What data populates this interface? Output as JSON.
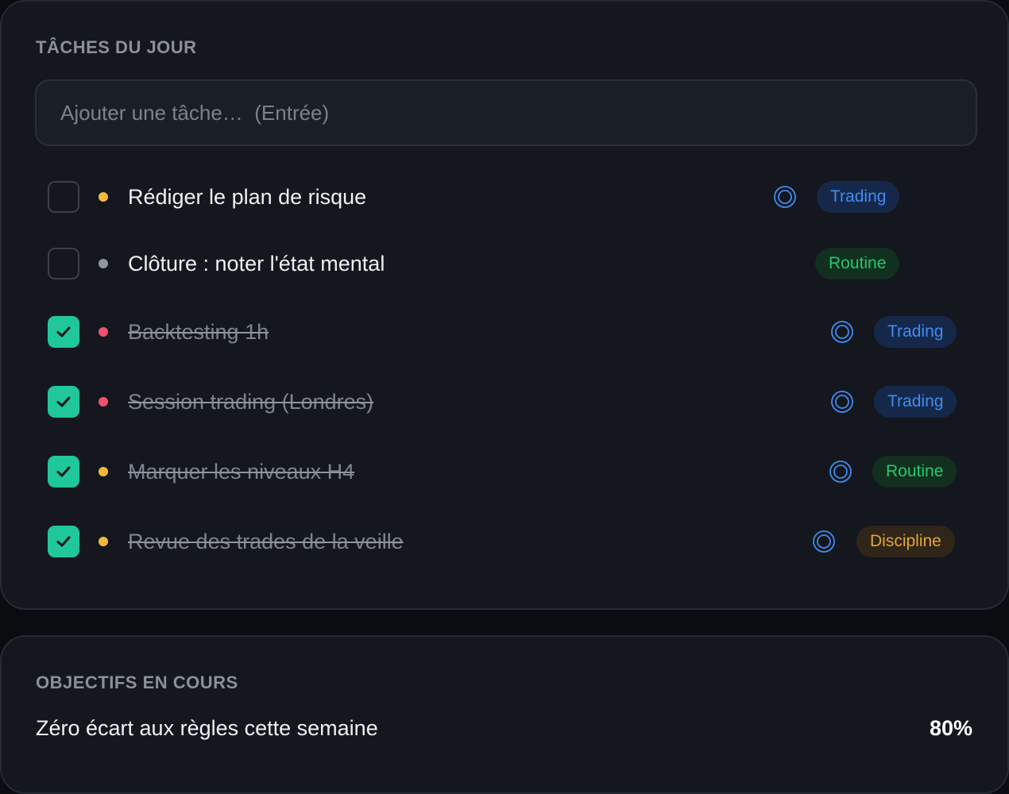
{
  "tasks_section": {
    "title": "TÂCHES DU JOUR",
    "input_placeholder": "Ajouter une tâche…  (Entrée)",
    "tasks": [
      {
        "label": "Rédiger le plan de risque",
        "done": false,
        "priority_color": "#f5b83d",
        "tag": "Trading",
        "tag_color": "blue",
        "has_goal_icon": true
      },
      {
        "label": "Clôture : noter l'état mental",
        "done": false,
        "priority_color": "#8f95a3",
        "tag": "Routine",
        "tag_color": "green",
        "has_goal_icon": false
      },
      {
        "label": "Backtesting 1h",
        "done": true,
        "priority_color": "#f0506e",
        "tag": "Trading",
        "tag_color": "blue",
        "has_goal_icon": true
      },
      {
        "label": "Session trading (Londres)",
        "done": true,
        "priority_color": "#f0506e",
        "tag": "Trading",
        "tag_color": "blue",
        "has_goal_icon": true
      },
      {
        "label": "Marquer les niveaux H4",
        "done": true,
        "priority_color": "#f5b83d",
        "tag": "Routine",
        "tag_color": "green",
        "has_goal_icon": true
      },
      {
        "label": "Revue des trades de la veille",
        "done": true,
        "priority_color": "#f5b83d",
        "tag": "Discipline",
        "tag_color": "amber",
        "has_goal_icon": true
      }
    ]
  },
  "goals_section": {
    "title": "OBJECTIFS EN COURS",
    "goals": [
      {
        "label": "Zéro écart aux règles cette semaine",
        "percent": "80%"
      }
    ]
  },
  "colors": {
    "background": "#0a0c10",
    "card": "#14171e",
    "accent_check": "#1fc79a",
    "tag_blue": "#3e8cf2",
    "tag_green": "#25c76f",
    "tag_amber": "#e3a43b",
    "priority_high": "#f0506e",
    "priority_medium": "#f5b83d",
    "priority_low": "#8f95a3"
  },
  "icons": {
    "check": "check-icon",
    "goal_link": "target-icon"
  }
}
